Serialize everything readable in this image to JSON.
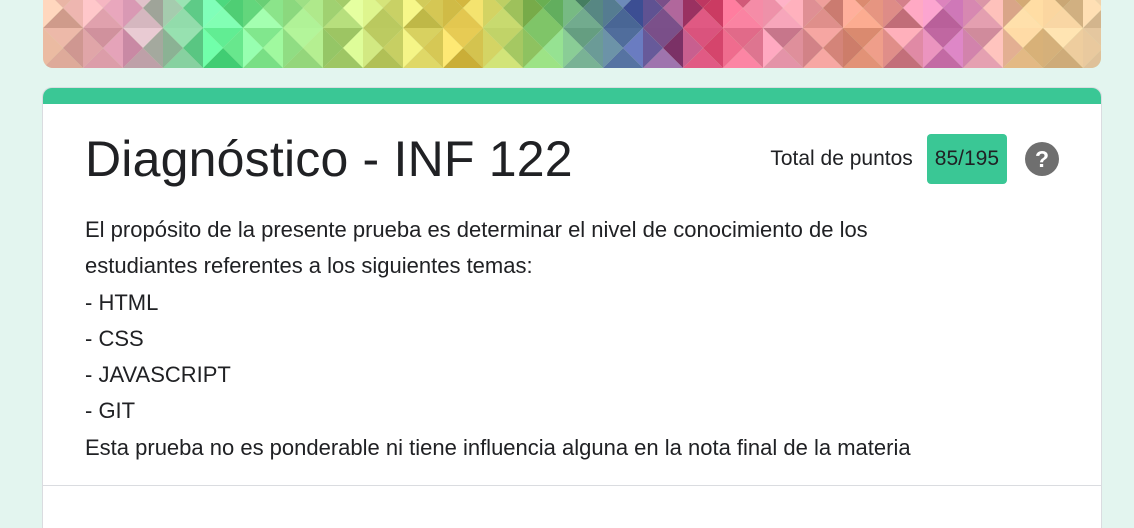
{
  "header": {
    "banner_icon": "colorful-triangle-pattern-banner"
  },
  "form": {
    "title": "Diagnóstico - INF 122",
    "points_label": "Total de puntos",
    "points_value": "85/195",
    "help_icon": "help-circle-icon",
    "help_glyph": "?",
    "description": [
      "El propósito de la presente prueba es determinar el nivel de conocimiento de los",
      "estudiantes referentes a los siguientes temas:",
      "- HTML",
      "- CSS",
      "- JAVASCRIPT",
      "- GIT",
      "Esta prueba no es ponderable ni tiene influencia alguna en la nota final de la materia"
    ]
  },
  "theme": {
    "accent": "#3ac795",
    "page_background": "#e3f5ef",
    "text": "#202124"
  }
}
